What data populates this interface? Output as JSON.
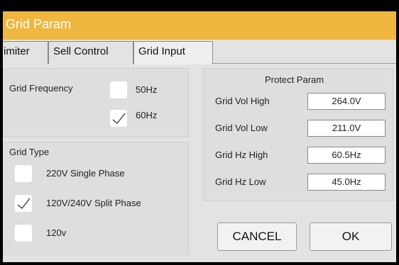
{
  "window": {
    "title": "Grid Param"
  },
  "tabs": [
    {
      "label": "imiter"
    },
    {
      "label": "Sell Control"
    },
    {
      "label": "Grid Input"
    }
  ],
  "grid_frequency": {
    "label": "Grid Frequency",
    "options": [
      {
        "label": "50Hz",
        "checked": false
      },
      {
        "label": "60Hz",
        "checked": true
      }
    ]
  },
  "grid_type": {
    "label": "Grid Type",
    "options": [
      {
        "label": "220V Single Phase",
        "checked": false
      },
      {
        "label": "120V/240V Split Phase",
        "checked": true
      },
      {
        "label": "120v",
        "checked": false
      }
    ]
  },
  "protect_param": {
    "title": "Protect Param",
    "rows": [
      {
        "label": "Grid Vol High",
        "value": "264.0V"
      },
      {
        "label": "Grid Vol Low",
        "value": "211.0V"
      },
      {
        "label": "Grid Hz High",
        "value": "60.5Hz"
      },
      {
        "label": "Grid Hz Low",
        "value": "45.0Hz"
      }
    ]
  },
  "buttons": {
    "cancel": "CANCEL",
    "ok": "OK"
  },
  "colors": {
    "titlebar": "#f0b73e",
    "background": "#e3e3e3",
    "panel": "#dedede"
  }
}
